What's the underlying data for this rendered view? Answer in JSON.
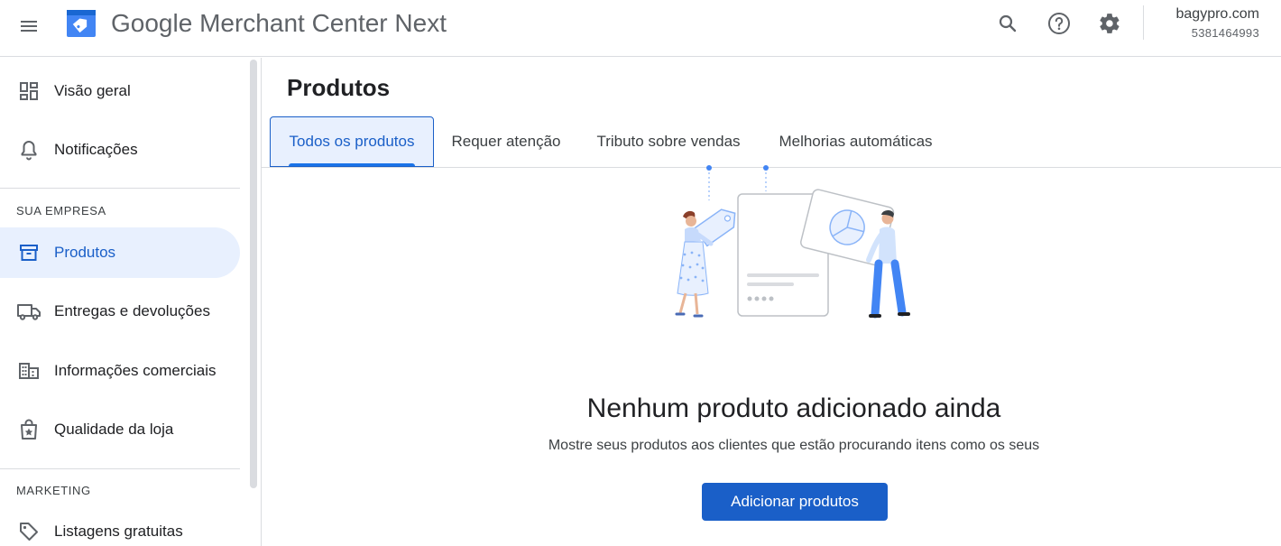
{
  "header": {
    "menu_icon": "hamburger-menu-icon",
    "logo_icon": "merchant-center-logo-icon",
    "title_brand": "Google",
    "title_product": "Merchant Center Next",
    "search_icon": "search-icon",
    "help_icon": "help-icon",
    "settings_icon": "gear-icon",
    "account_name": "bagypro.com",
    "account_id": "5381464993"
  },
  "sidebar": {
    "top_items": [
      {
        "label": "Visão geral",
        "icon": "dashboard-icon"
      },
      {
        "label": "Notificações",
        "icon": "bell-icon"
      }
    ],
    "sections": [
      {
        "title": "SUA EMPRESA",
        "items": [
          {
            "label": "Produtos",
            "icon": "archive-box-icon",
            "active": true
          },
          {
            "label": "Entregas e devoluções",
            "icon": "truck-icon"
          },
          {
            "label": "Informações comerciais",
            "icon": "building-icon"
          },
          {
            "label": "Qualidade da loja",
            "icon": "shopping-bag-star-icon"
          }
        ]
      },
      {
        "title": "MARKETING",
        "items": [
          {
            "label": "Listagens gratuitas",
            "icon": "tag-icon"
          }
        ]
      }
    ]
  },
  "main": {
    "page_title": "Produtos",
    "tabs": [
      {
        "label": "Todos os produtos",
        "active": true
      },
      {
        "label": "Requer atenção"
      },
      {
        "label": "Tributo sobre vendas"
      },
      {
        "label": "Melhorias automáticas"
      }
    ],
    "empty_state": {
      "illustration": "people-with-product-cards-illustration",
      "title": "Nenhum produto adicionado ainda",
      "subtitle": "Mostre seus produtos aos clientes que estão procurando itens como os seus",
      "button_label": "Adicionar produtos"
    }
  },
  "colors": {
    "accent": "#1a5fc8",
    "active_bg": "#e8f0fe",
    "divider": "#dadce0"
  }
}
